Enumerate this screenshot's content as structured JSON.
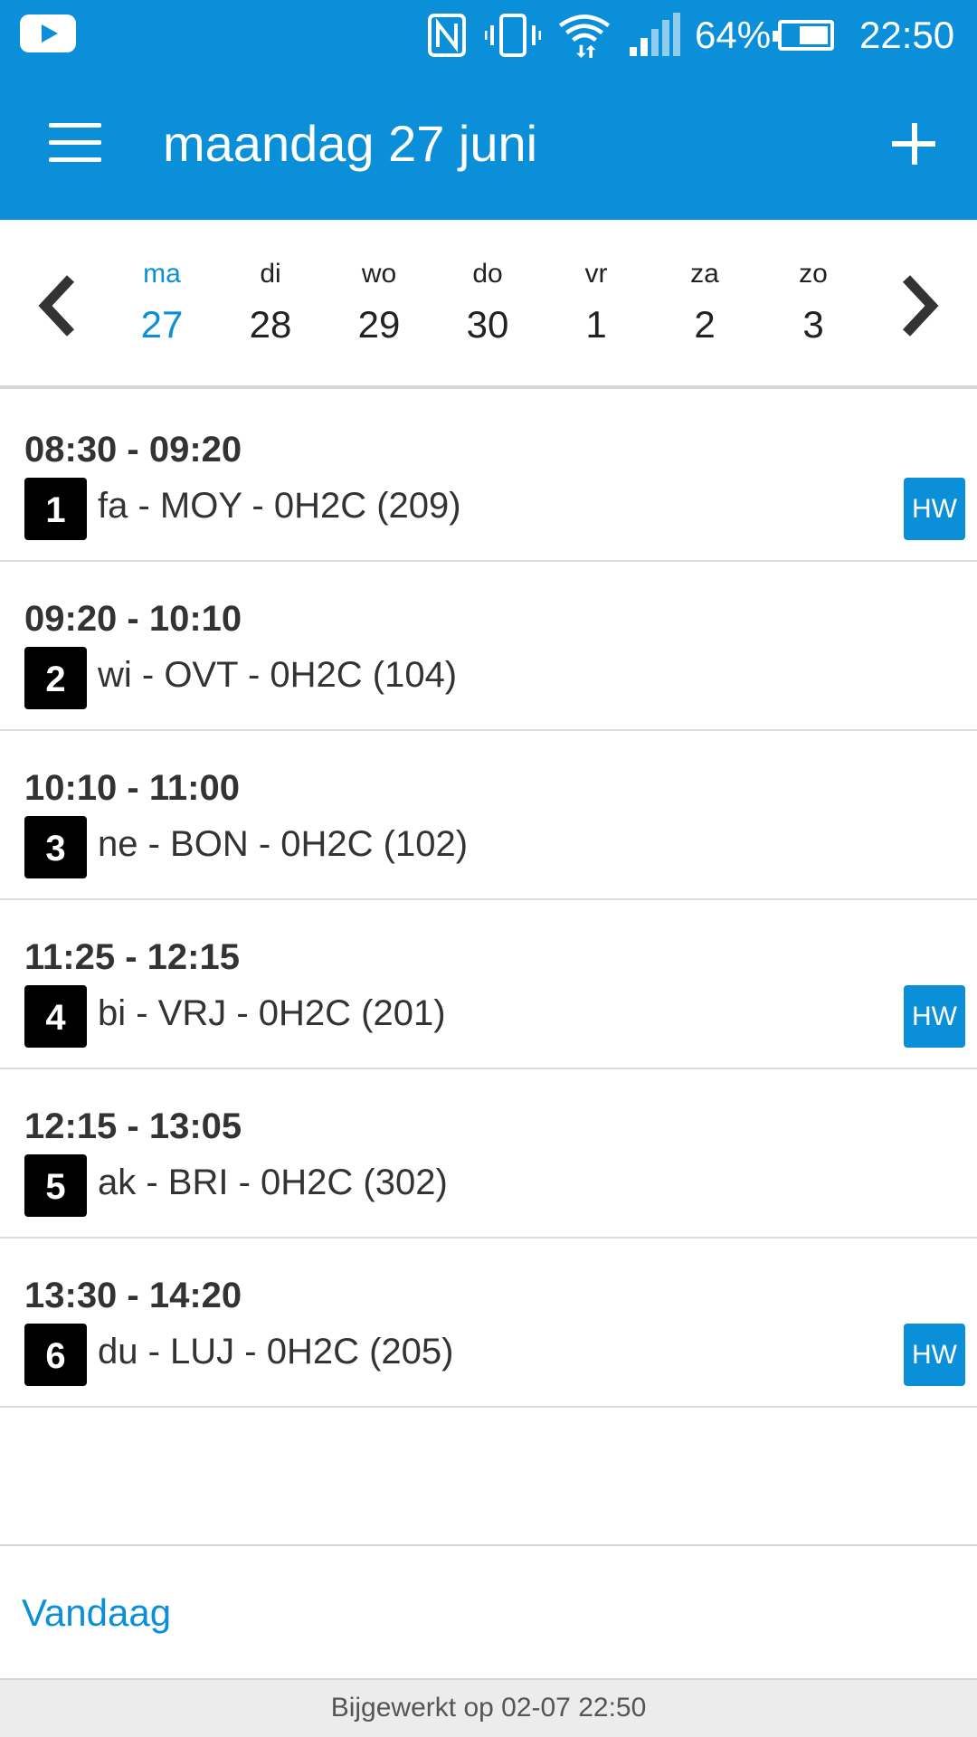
{
  "status_bar": {
    "battery_percent": "64%",
    "battery_level": 0.64,
    "time": "22:50",
    "icons": [
      "youtube-icon",
      "nfc-icon",
      "vibrate-icon",
      "wifi-icon",
      "signal-icon",
      "battery-icon"
    ]
  },
  "app_bar": {
    "title": "maandag 27 juni",
    "menu_icon": "hamburger-menu-icon",
    "add_icon": "plus-icon",
    "background": "#0a8fd8"
  },
  "week": {
    "days": [
      {
        "name": "ma",
        "date": "27",
        "active": true
      },
      {
        "name": "di",
        "date": "28",
        "active": false
      },
      {
        "name": "wo",
        "date": "29",
        "active": false
      },
      {
        "name": "do",
        "date": "30",
        "active": false
      },
      {
        "name": "vr",
        "date": "1",
        "active": false
      },
      {
        "name": "za",
        "date": "2",
        "active": false
      },
      {
        "name": "zo",
        "date": "3",
        "active": false
      }
    ],
    "accent": "#0a8fd8"
  },
  "lessons": [
    {
      "time": "08:30 - 09:20",
      "number": "1",
      "description": "fa - MOY - 0H2C (209)",
      "hw": "HW"
    },
    {
      "time": "09:20 - 10:10",
      "number": "2",
      "description": "wi - OVT - 0H2C (104)",
      "hw": ""
    },
    {
      "time": "10:10 - 11:00",
      "number": "3",
      "description": "ne - BON - 0H2C (102)",
      "hw": ""
    },
    {
      "time": "11:25 - 12:15",
      "number": "4",
      "description": "bi - VRJ - 0H2C (201)",
      "hw": "HW"
    },
    {
      "time": "12:15 - 13:05",
      "number": "5",
      "description": "ak - BRI - 0H2C (302)",
      "hw": ""
    },
    {
      "time": "13:30 - 14:20",
      "number": "6",
      "description": "du - LUJ - 0H2C (205)",
      "hw": "HW"
    }
  ],
  "footer": {
    "today_label": "Vandaag",
    "updated_text": "Bijgewerkt op 02-07 22:50"
  }
}
